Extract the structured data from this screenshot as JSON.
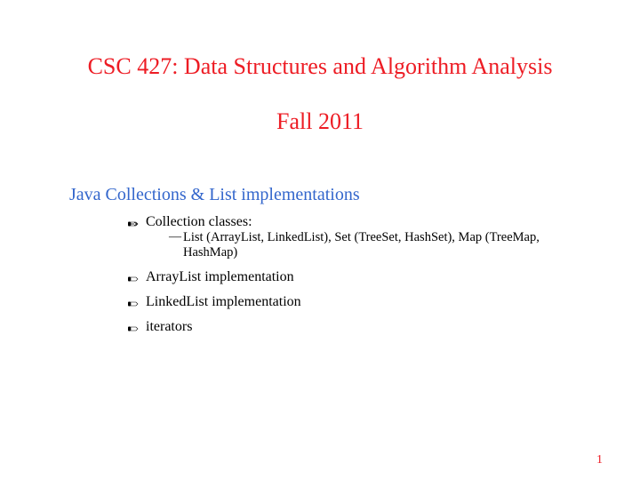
{
  "title": {
    "line1": "CSC 427: Data Structures and Algorithm Analysis",
    "line2": "Fall 2011"
  },
  "subtitle": "Java Collections & List implementations",
  "bullets": [
    {
      "text": "Collection classes:",
      "sub": "List (ArrayList, LinkedList), Set (TreeSet, HashSet), Map (TreeMap, HashMap)"
    },
    {
      "text": "ArrayList implementation",
      "sub": null
    },
    {
      "text": "LinkedList implementation",
      "sub": null
    },
    {
      "text": "iterators",
      "sub": null
    }
  ],
  "pageNumber": "1",
  "colors": {
    "accent": "#ed1c24",
    "link": "#3366cc",
    "text": "#000000"
  }
}
